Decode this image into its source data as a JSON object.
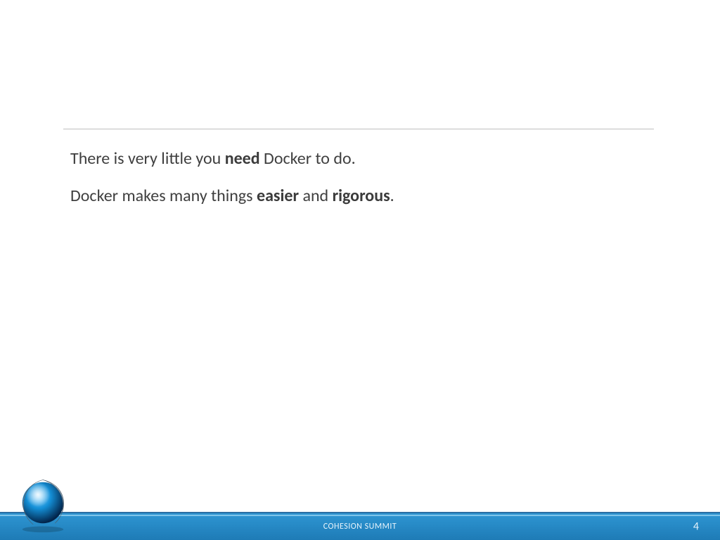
{
  "body": {
    "line1": {
      "pre": "There is very little you ",
      "b1": "need",
      "post": " Docker to do."
    },
    "line2": {
      "pre": "Docker makes many things ",
      "b1": "easier",
      "mid": " and ",
      "b2": "rigorous",
      "post": "."
    }
  },
  "footer": {
    "title": "COHESION SUMMIT",
    "page_number": "4"
  }
}
